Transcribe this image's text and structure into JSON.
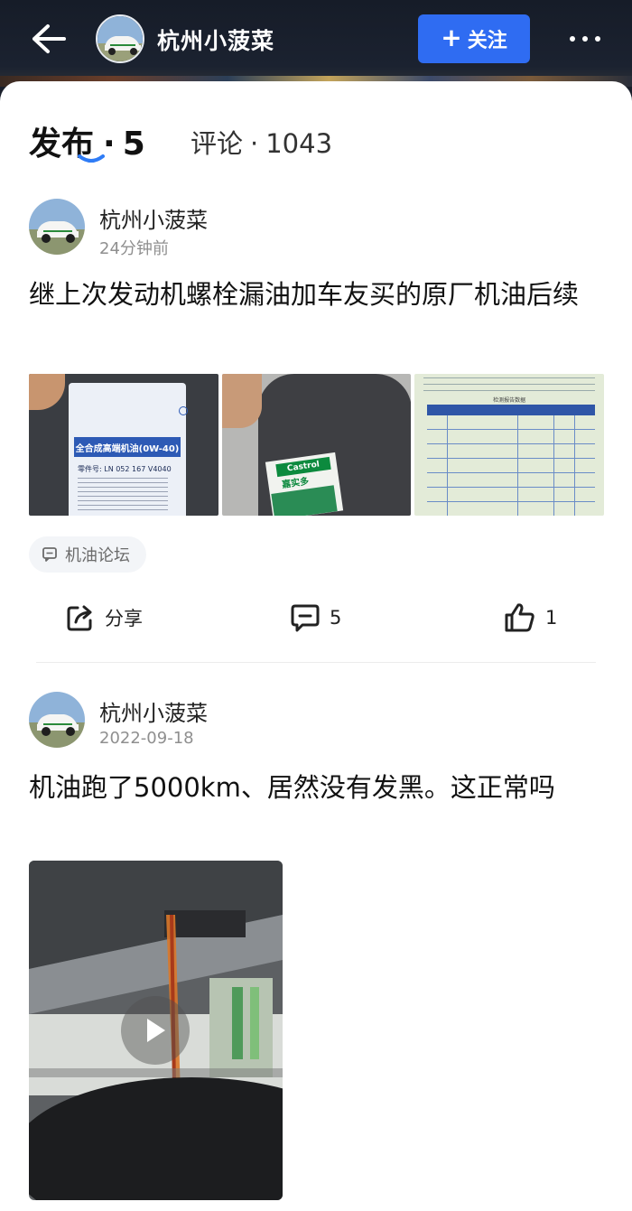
{
  "header": {
    "user_name": "杭州小菠菜",
    "follow_label": "关注",
    "follow_plus": "+"
  },
  "tabs": {
    "published_label": "发布",
    "published_count": "5",
    "comments_label": "评论",
    "comments_count": "1043",
    "separator": "·"
  },
  "posts": [
    {
      "author": "杭州小菠菜",
      "time": "24分钟前",
      "text": "继上次发动机螺栓漏油加车友买的原厂机油后续",
      "images": [
        {
          "label_line1": "全合成高端机油(0W-40)",
          "label_line2": "零件号: LN 052 167 V4040"
        },
        {
          "label_line1": "Castrol",
          "label_line2": "嘉实多"
        },
        {
          "label_line1": "检测报告数据"
        }
      ],
      "tag": "机油论坛",
      "actions": {
        "share_label": "分享",
        "comment_count": "5",
        "like_count": "1"
      }
    },
    {
      "author": "杭州小菠菜",
      "time": "2022-09-18",
      "text": "机油跑了5000km、居然没有发黑。这正常吗",
      "has_video": true
    }
  ],
  "icons": {
    "back": "back-arrow-icon",
    "more": "more-dots-icon",
    "share": "share-icon",
    "comment": "comment-icon",
    "like": "thumbs-up-icon",
    "tag": "forum-tag-icon",
    "play": "play-icon"
  },
  "colors": {
    "accent": "#2f6cf2",
    "header_bg": "#1a1f2b",
    "tab_underline": "#2f7cf6"
  }
}
